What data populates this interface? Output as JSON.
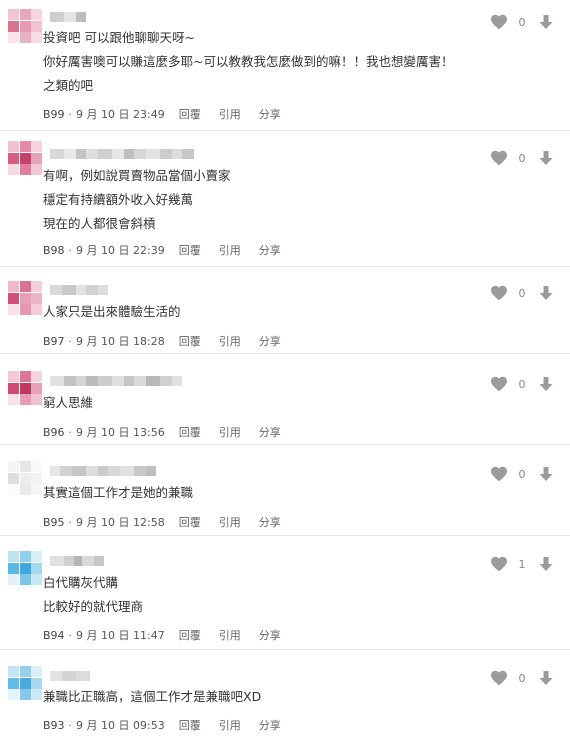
{
  "comments": [
    {
      "lines": [
        "投資吧 可以跟他聊聊天呀~",
        "你好厲害噢可以賺這麼多耶~可以教教我怎麼做到的嘛！！我也想變厲害！",
        "之類的吧"
      ],
      "floor": "B99",
      "date": "9 月 10 日 23:49",
      "reply": "回覆",
      "quote": "引用",
      "share": "分享",
      "likes": "0",
      "avatar": [
        "#f3c4d3",
        "#e8a6bd",
        "#f7d6e1",
        "#d9738f",
        "#e99ab1",
        "#f2c2d1",
        "#fbe3ea",
        "#eab1c3",
        "#f8dbe4"
      ],
      "name": [
        "#cfcfcf",
        "#e4e4e4",
        "#bdbdbd"
      ]
    },
    {
      "lines": [
        "有啊，例如說買賣物品當個小賣家",
        "穩定有持續額外收入好幾萬",
        "現在的人都很會斜槓"
      ],
      "floor": "B98",
      "date": "9 月 10 日 22:39",
      "reply": "回覆",
      "quote": "引用",
      "share": "分享",
      "likes": "0",
      "avatar": [
        "#f2c1d0",
        "#e48aa6",
        "#f6d2de",
        "#d85d80",
        "#c9406a",
        "#e6a3b8",
        "#f8dae4",
        "#e27f9e",
        "#f3c6d4"
      ],
      "name": [
        "#d8d8d8",
        "#e9e9e9",
        "#c4c4c4",
        "#dedede",
        "#cfcfcf",
        "#e6e6e6",
        "#bfbfbf",
        "#d6d6d6",
        "#e2e2e2",
        "#cccccc",
        "#dcdcdc",
        "#c8c8c8"
      ]
    },
    {
      "lines": [
        "人家只是出來體驗生活的"
      ],
      "floor": "B97",
      "date": "9 月 10 日 18:28",
      "reply": "回覆",
      "quote": "引用",
      "share": "分享",
      "likes": "0",
      "avatar": [
        "#f0b8c9",
        "#dc7292",
        "#f5cfdb",
        "#d0527a",
        "#e8a0b6",
        "#eeb5c6",
        "#f9dfe7",
        "#e696ae",
        "#f4cbd7"
      ],
      "name": [
        "#d9d9d9",
        "#c9c9c9",
        "#e3e3e3",
        "#d1d1d1",
        "#dddddd"
      ]
    },
    {
      "lines": [
        "窮人思維"
      ],
      "floor": "B96",
      "date": "9 月 10 日 13:56",
      "reply": "回覆",
      "quote": "引用",
      "share": "分享",
      "likes": "0",
      "avatar": [
        "#f4c8d6",
        "#dd7694",
        "#f7d5e0",
        "#cf4a73",
        "#c0385f",
        "#e7a2b7",
        "#fae1e9",
        "#ea9cb3",
        "#f2c0cf"
      ],
      "name": [
        "#e2e2e2",
        "#c2c2c2",
        "#d5d5d5",
        "#bcbcbc",
        "#cdcdcd",
        "#dfdfdf",
        "#c6c6c6",
        "#d9d9d9",
        "#b8b8b8",
        "#d0d0d0",
        "#e0e0e0"
      ]
    },
    {
      "lines": [
        "其實這個工作才是她的兼職"
      ],
      "floor": "B95",
      "date": "9 月 10 日 12:58",
      "reply": "回覆",
      "quote": "引用",
      "share": "分享",
      "likes": "0",
      "avatar": [
        "#f4f4f4",
        "#e6e6e6",
        "#f9f9f9",
        "#dedede",
        "#eeeeee",
        "#f2f2f2",
        "#fbfbfb",
        "#e9e9e9",
        "#f6f6f6"
      ],
      "name": [
        "#e6e6e6",
        "#d2d2d2",
        "#c6c6c6",
        "#dddddd",
        "#cbcbcb",
        "#d8d8d8",
        "#e1e1e1",
        "#c9c9c9",
        "#bfbfbf"
      ]
    },
    {
      "lines": [
        "白代購灰代購",
        "比較好的就代理商"
      ],
      "floor": "B94",
      "date": "9 月 10 日 11:47",
      "reply": "回覆",
      "quote": "引用",
      "share": "分享",
      "likes": "1",
      "avatar": [
        "#bfe3f3",
        "#8fd0ee",
        "#d8eef8",
        "#5bb9e6",
        "#3fa8dc",
        "#a3d8f0",
        "#e2f2fa",
        "#7cc6ea",
        "#c6e7f5"
      ],
      "name": [
        "#e0e0e0",
        "#cfcfcf",
        "#b5b5b5",
        "#d9d9d9",
        "#c7c7c7"
      ]
    },
    {
      "lines": [
        "兼職比正職高，這個工作才是兼職吧XD"
      ],
      "floor": "B93",
      "date": "9 月 10 日 09:53",
      "reply": "回覆",
      "quote": "引用",
      "share": "分享",
      "likes": "0",
      "avatar": [
        "#c3e5f4",
        "#93d2ee",
        "#dbeff8",
        "#64bde7",
        "#47abdd",
        "#a7daf1",
        "#e4f3fa",
        "#82c9eb",
        "#cae9f6"
      ],
      "name": [
        "#e3e3e3",
        "#d4d4d4",
        "#dcdcdc"
      ]
    }
  ]
}
